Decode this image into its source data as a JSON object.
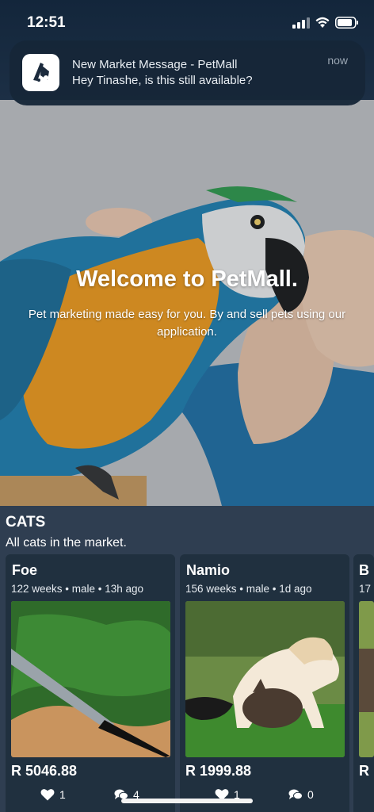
{
  "status_bar": {
    "time": "12:51"
  },
  "notification": {
    "title": "New Market Message - PetMall",
    "body": "Hey Tinashe, is this still available?",
    "time": "now"
  },
  "hero": {
    "title": "Welcome to PetMall.",
    "subtitle": "Pet marketing made easy for you. By and sell pets using our application."
  },
  "section": {
    "title": "CATS",
    "subtitle": "All cats in the market."
  },
  "cards": [
    {
      "name": "Foe",
      "meta": "122 weeks • male • 13h ago",
      "price": "R 5046.88",
      "likes": "1",
      "comments": "4"
    },
    {
      "name": "Namio",
      "meta": "156 weeks • male • 1d ago",
      "price": "R 1999.88",
      "likes": "1",
      "comments": "0"
    },
    {
      "name": "B",
      "meta": "17",
      "price": "R"
    }
  ],
  "colors": {
    "background": "#2b3a4c",
    "card": "#20303f",
    "notification": "#162638"
  }
}
